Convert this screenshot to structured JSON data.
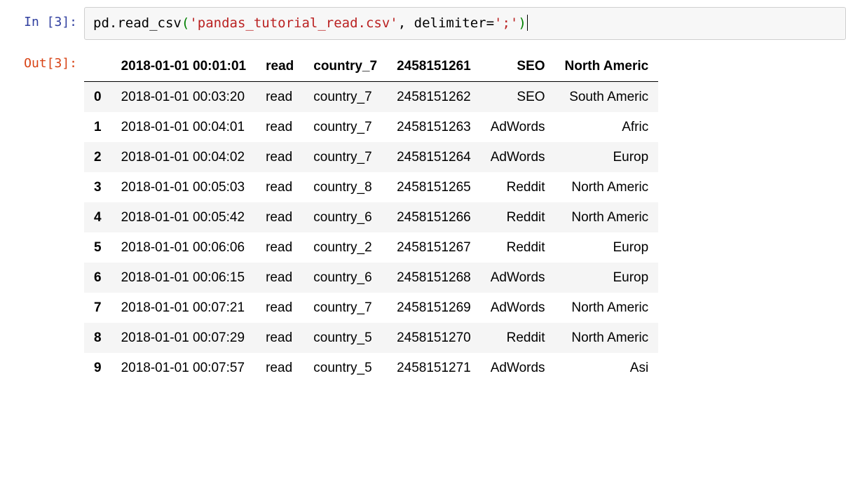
{
  "cell": {
    "in_prompt": "In [3]:",
    "out_prompt": "Out[3]:",
    "code": {
      "obj": "pd",
      "dot": ".",
      "func": "read_csv",
      "lparen": "(",
      "string": "'pandas_tutorial_read.csv'",
      "comma_space": ", ",
      "kwarg": "delimiter",
      "eq": "=",
      "kwarg_val": "';'",
      "rparen": ")"
    }
  },
  "dataframe": {
    "corner": "",
    "columns": [
      "2018-01-01 00:01:01",
      "read",
      "country_7",
      "2458151261",
      "SEO",
      "North Americ"
    ],
    "rows": [
      {
        "idx": "0",
        "cells": [
          "2018-01-01 00:03:20",
          "read",
          "country_7",
          "2458151262",
          "SEO",
          "South Americ"
        ]
      },
      {
        "idx": "1",
        "cells": [
          "2018-01-01 00:04:01",
          "read",
          "country_7",
          "2458151263",
          "AdWords",
          "Afric"
        ]
      },
      {
        "idx": "2",
        "cells": [
          "2018-01-01 00:04:02",
          "read",
          "country_7",
          "2458151264",
          "AdWords",
          "Europ"
        ]
      },
      {
        "idx": "3",
        "cells": [
          "2018-01-01 00:05:03",
          "read",
          "country_8",
          "2458151265",
          "Reddit",
          "North Americ"
        ]
      },
      {
        "idx": "4",
        "cells": [
          "2018-01-01 00:05:42",
          "read",
          "country_6",
          "2458151266",
          "Reddit",
          "North Americ"
        ]
      },
      {
        "idx": "5",
        "cells": [
          "2018-01-01 00:06:06",
          "read",
          "country_2",
          "2458151267",
          "Reddit",
          "Europ"
        ]
      },
      {
        "idx": "6",
        "cells": [
          "2018-01-01 00:06:15",
          "read",
          "country_6",
          "2458151268",
          "AdWords",
          "Europ"
        ]
      },
      {
        "idx": "7",
        "cells": [
          "2018-01-01 00:07:21",
          "read",
          "country_7",
          "2458151269",
          "AdWords",
          "North Americ"
        ]
      },
      {
        "idx": "8",
        "cells": [
          "2018-01-01 00:07:29",
          "read",
          "country_5",
          "2458151270",
          "Reddit",
          "North Americ"
        ]
      },
      {
        "idx": "9",
        "cells": [
          "2018-01-01 00:07:57",
          "read",
          "country_5",
          "2458151271",
          "AdWords",
          "Asi"
        ]
      }
    ]
  }
}
